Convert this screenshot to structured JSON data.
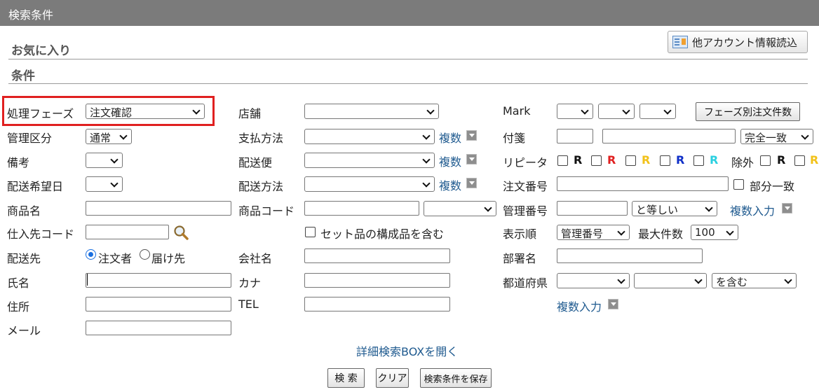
{
  "panel": {
    "title": "検索条件"
  },
  "favorites": {
    "label": "お気に入り"
  },
  "conditions": {
    "label": "条件"
  },
  "account_button": {
    "label": "他アカウント情報読込",
    "icon": "account-info-icon"
  },
  "fields": {
    "phase": {
      "label": "処理フェーズ",
      "value": "注文確認"
    },
    "mgmt_class": {
      "label": "管理区分",
      "value": "通常"
    },
    "remarks": {
      "label": "備考",
      "value": ""
    },
    "delivery_date": {
      "label": "配送希望日",
      "value": ""
    },
    "product_name": {
      "label": "商品名",
      "value": ""
    },
    "supplier_code": {
      "label": "仕入先コード",
      "value": ""
    },
    "ship_to": {
      "label": "配送先",
      "options": [
        "注文者",
        "届け先"
      ],
      "selected": "注文者"
    },
    "name": {
      "label": "氏名",
      "value": ""
    },
    "address": {
      "label": "住所",
      "value": ""
    },
    "mail": {
      "label": "メール",
      "value": ""
    },
    "store": {
      "label": "店舗",
      "value": ""
    },
    "payment": {
      "label": "支払方法",
      "value": ""
    },
    "carrier": {
      "label": "配送便",
      "value": ""
    },
    "ship_method": {
      "label": "配送方法",
      "value": ""
    },
    "product_code": {
      "label": "商品コード",
      "value": ""
    },
    "set_item": {
      "label": "セット品の構成品を含む",
      "checked": false
    },
    "company": {
      "label": "会社名",
      "value": ""
    },
    "kana": {
      "label": "カナ",
      "value": ""
    },
    "tel": {
      "label": "TEL",
      "value": ""
    },
    "mark": {
      "label": "Mark"
    },
    "phase_count_button": {
      "label": "フェーズ別注文件数"
    },
    "tag": {
      "label": "付箋",
      "match": "完全一致"
    },
    "repeater": {
      "label": "リピータ",
      "letter": "R",
      "colors": [
        "#111111",
        "#e02020",
        "#f2c21a",
        "#1030c8",
        "#2ad0e0"
      ],
      "exclude_label": "除外",
      "exclude_colors": [
        "#111111",
        "#f2c21a"
      ]
    },
    "order_no": {
      "label": "注文番号",
      "partial_label": "部分一致"
    },
    "mgmt_no": {
      "label": "管理番号",
      "condition": "と等しい"
    },
    "display_order": {
      "label": "表示順",
      "value": "管理番号",
      "max_label": "最大件数",
      "max_value": "100"
    },
    "department": {
      "label": "部署名",
      "value": ""
    },
    "prefecture": {
      "label": "都道府県",
      "condition": "を含む"
    }
  },
  "multi_label": "複数",
  "multi_input_label": "複数入力",
  "detail_link": "詳細検索BOXを開く",
  "buttons": {
    "search": "検 索",
    "clear": "クリア",
    "save": "検索条件を保存"
  }
}
